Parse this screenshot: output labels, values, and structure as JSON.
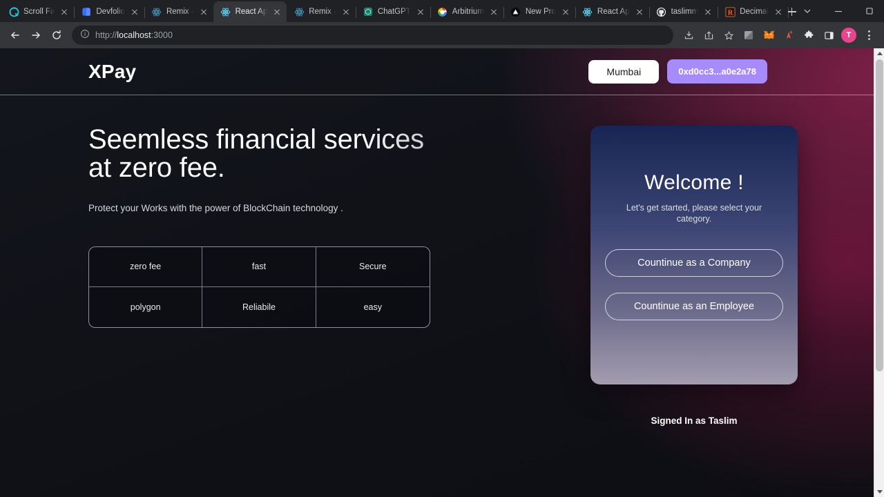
{
  "browser": {
    "tabs": [
      {
        "title": "Scroll Fa",
        "icon": "scroll-favicon",
        "active": false,
        "icon_color": "#27c5d4"
      },
      {
        "title": "Devfolio",
        "icon": "devfolio-favicon",
        "active": false,
        "icon_color": "#3770ff"
      },
      {
        "title": "Remix - ",
        "icon": "remix-favicon",
        "active": false,
        "icon_color": "#4a8fb5"
      },
      {
        "title": "React Ap",
        "icon": "react-favicon",
        "active": true,
        "icon_color": "#61dafb"
      },
      {
        "title": "Remix - ",
        "icon": "remix-favicon",
        "active": false,
        "icon_color": "#4a8fb5"
      },
      {
        "title": "ChatGPT",
        "icon": "chatgpt-favicon",
        "active": false,
        "icon_color": "#74aa9c"
      },
      {
        "title": "Arbitrium",
        "icon": "google-favicon",
        "active": false,
        "icon_color": "#4285f4"
      },
      {
        "title": "New Pro",
        "icon": "vercel-favicon",
        "active": false,
        "icon_color": "#ffffff"
      },
      {
        "title": "React Ap",
        "icon": "react-favicon",
        "active": false,
        "icon_color": "#61dafb"
      },
      {
        "title": "taslimm",
        "icon": "github-favicon",
        "active": false,
        "icon_color": "#ffffff"
      },
      {
        "title": "Decimal",
        "icon": "r-favicon",
        "active": false,
        "icon_color": "#f26522"
      }
    ],
    "new_tab_label": "+",
    "window_controls": {
      "tab_search": "tab-search-chevron",
      "minimize": "minimize",
      "maximize": "maximize",
      "close": "close"
    },
    "toolbar": {
      "back": "back-arrow",
      "forward": "forward-arrow",
      "reload": "reload",
      "url_prefix": "http://",
      "url_host": "localhost",
      "url_suffix": ":3000",
      "site_info_icon": "info-circle-icon",
      "icons": [
        "install-app-icon",
        "share-icon",
        "bookmark-star-icon",
        "gray-extension-icon",
        "metamask-fox-icon",
        "arrow-plus-extension-icon",
        "extensions-puzzle-icon",
        "side-panel-icon"
      ],
      "profile_initial": "T",
      "profile_color": "#e8468c",
      "menu": "three-dot-menu"
    }
  },
  "page": {
    "header": {
      "brand": "XPay",
      "network_button": "Mumbai",
      "wallet_button": "0xd0cc3...a0e2a78",
      "wallet_color": "#a78bfa"
    },
    "hero": {
      "headline": "Seemless financial services\nat zero fee.",
      "subhead": "Protect your Works with the power of BlockChain technology ."
    },
    "features": [
      "zero fee",
      "fast",
      "Secure",
      "polygon",
      "Reliabile",
      "easy"
    ],
    "welcome_card": {
      "title": "Welcome !",
      "subtitle": "Let's get started, please select your category.",
      "company_button": "Countinue as a Company",
      "employee_button": "Countinue as an Employee"
    },
    "footer_status": "Signed In as Taslim"
  }
}
